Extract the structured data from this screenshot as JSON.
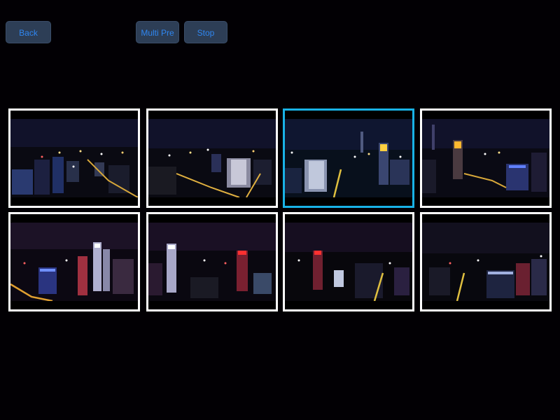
{
  "toolbar": {
    "back_label": "Back",
    "multi_pre_label": "Multi Pre",
    "stop_label": "Stop"
  },
  "colors": {
    "button_bg": "#2d3e56",
    "button_text": "#2f86f0",
    "thumb_border": "#ffffff",
    "thumb_selected_border": "#19b2e6",
    "background": "#020004"
  },
  "thumbnails": [
    {
      "subject": "night city aerial, lit road left",
      "selected": false
    },
    {
      "subject": "night city aerial, lit highway center",
      "selected": false
    },
    {
      "subject": "night city aerial, tall lit towers",
      "selected": true
    },
    {
      "subject": "night city aerial, orange-top tower",
      "selected": false
    },
    {
      "subject": "night skyline, white lit towers",
      "selected": false
    },
    {
      "subject": "night skyline, red-top tower",
      "selected": false
    },
    {
      "subject": "night skyline, red lights dim",
      "selected": false
    },
    {
      "subject": "night skyline, yellow road",
      "selected": false
    }
  ]
}
